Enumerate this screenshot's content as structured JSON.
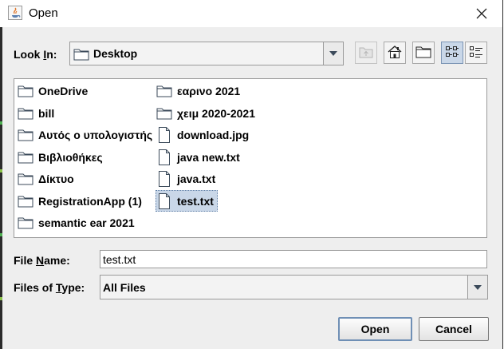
{
  "window": {
    "title": "Open"
  },
  "lookin": {
    "label_pre": "Look ",
    "label_mn": "I",
    "label_post": "n:",
    "value": "Desktop"
  },
  "toolbar": {
    "up_icon": "folder-up-icon",
    "home_icon": "home-icon",
    "new_folder_icon": "new-folder-icon",
    "list_view_icon": "list-view-icon",
    "details_view_icon": "details-view-icon"
  },
  "files": {
    "col1": [
      {
        "name": "OneDrive",
        "type": "folder"
      },
      {
        "name": "bill",
        "type": "folder"
      },
      {
        "name": "Αυτός ο υπολογιστής",
        "type": "folder"
      },
      {
        "name": "Βιβλιοθήκες",
        "type": "folder"
      },
      {
        "name": "Δίκτυο",
        "type": "folder"
      },
      {
        "name": "RegistrationApp (1)",
        "type": "folder"
      },
      {
        "name": "semantic ear 2021",
        "type": "folder"
      }
    ],
    "col2": [
      {
        "name": "εαρινο 2021",
        "type": "folder"
      },
      {
        "name": "χειμ 2020-2021",
        "type": "folder"
      },
      {
        "name": "download.jpg",
        "type": "file"
      },
      {
        "name": "java new.txt",
        "type": "file"
      },
      {
        "name": "java.txt",
        "type": "file"
      },
      {
        "name": "test.txt",
        "type": "file",
        "selected": true
      }
    ]
  },
  "filename": {
    "label_pre": "File ",
    "label_mn": "N",
    "label_post": "ame:",
    "value": "test.txt"
  },
  "filetype": {
    "label_pre": "Files of ",
    "label_mn": "T",
    "label_post": "ype:",
    "value": "All Files"
  },
  "buttons": {
    "open": "Open",
    "cancel": "Cancel"
  },
  "colors": {
    "selection": "#c9d7e8",
    "dialog_bg": "#eeeeee",
    "default_border": "#6f8fb5"
  }
}
